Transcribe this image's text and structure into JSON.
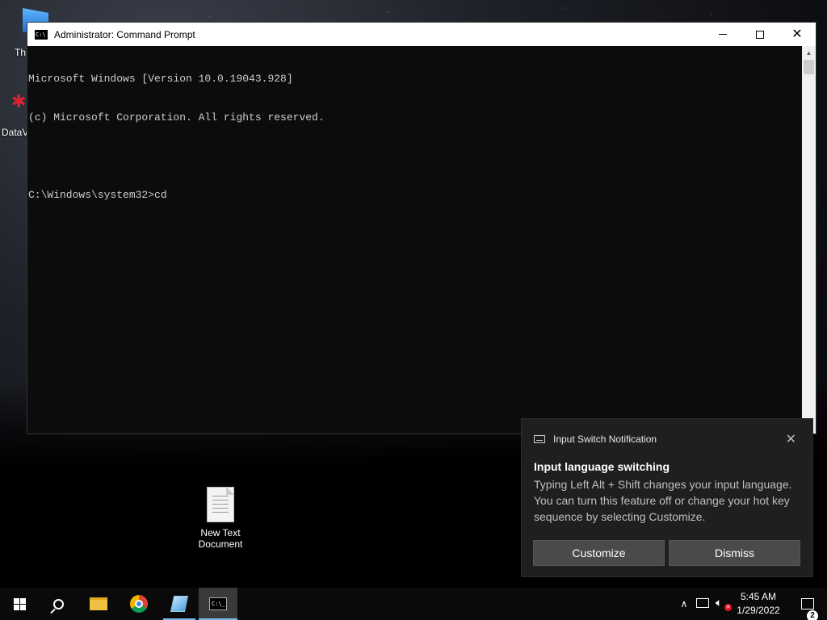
{
  "desktop": {
    "partial_icon_1_label": "Th",
    "partial_icon_2_label": "DataV",
    "new_text_document_label": "New Text Document"
  },
  "cmd_window": {
    "title": "Administrator: Command Prompt",
    "console_lines": [
      "Microsoft Windows [Version 10.0.19043.928]",
      "(c) Microsoft Corporation. All rights reserved.",
      "",
      "C:\\Windows\\system32>cd"
    ]
  },
  "notification": {
    "app_name": "Input Switch Notification",
    "title": "Input language switching",
    "body": "Typing Left Alt + Shift changes your input language. You can turn this feature off or change your hot key sequence by selecting Customize.",
    "customize_label": "Customize",
    "dismiss_label": "Dismiss"
  },
  "taskbar": {
    "time": "5:45 AM",
    "date": "1/29/2022",
    "notification_count": "2"
  },
  "icons": {
    "start": "windows-logo-icon",
    "search": "search-icon",
    "explorer": "folder-icon",
    "chrome": "chrome-icon",
    "notepad": "notepad-icon",
    "cmd": "command-prompt-icon"
  },
  "colors": {
    "console_bg": "#0c0c0c",
    "console_fg": "#cccccc",
    "toast_bg": "#1f1f1f",
    "taskbar_bg": "#0a0a0a",
    "accent": "#76b9ed"
  }
}
